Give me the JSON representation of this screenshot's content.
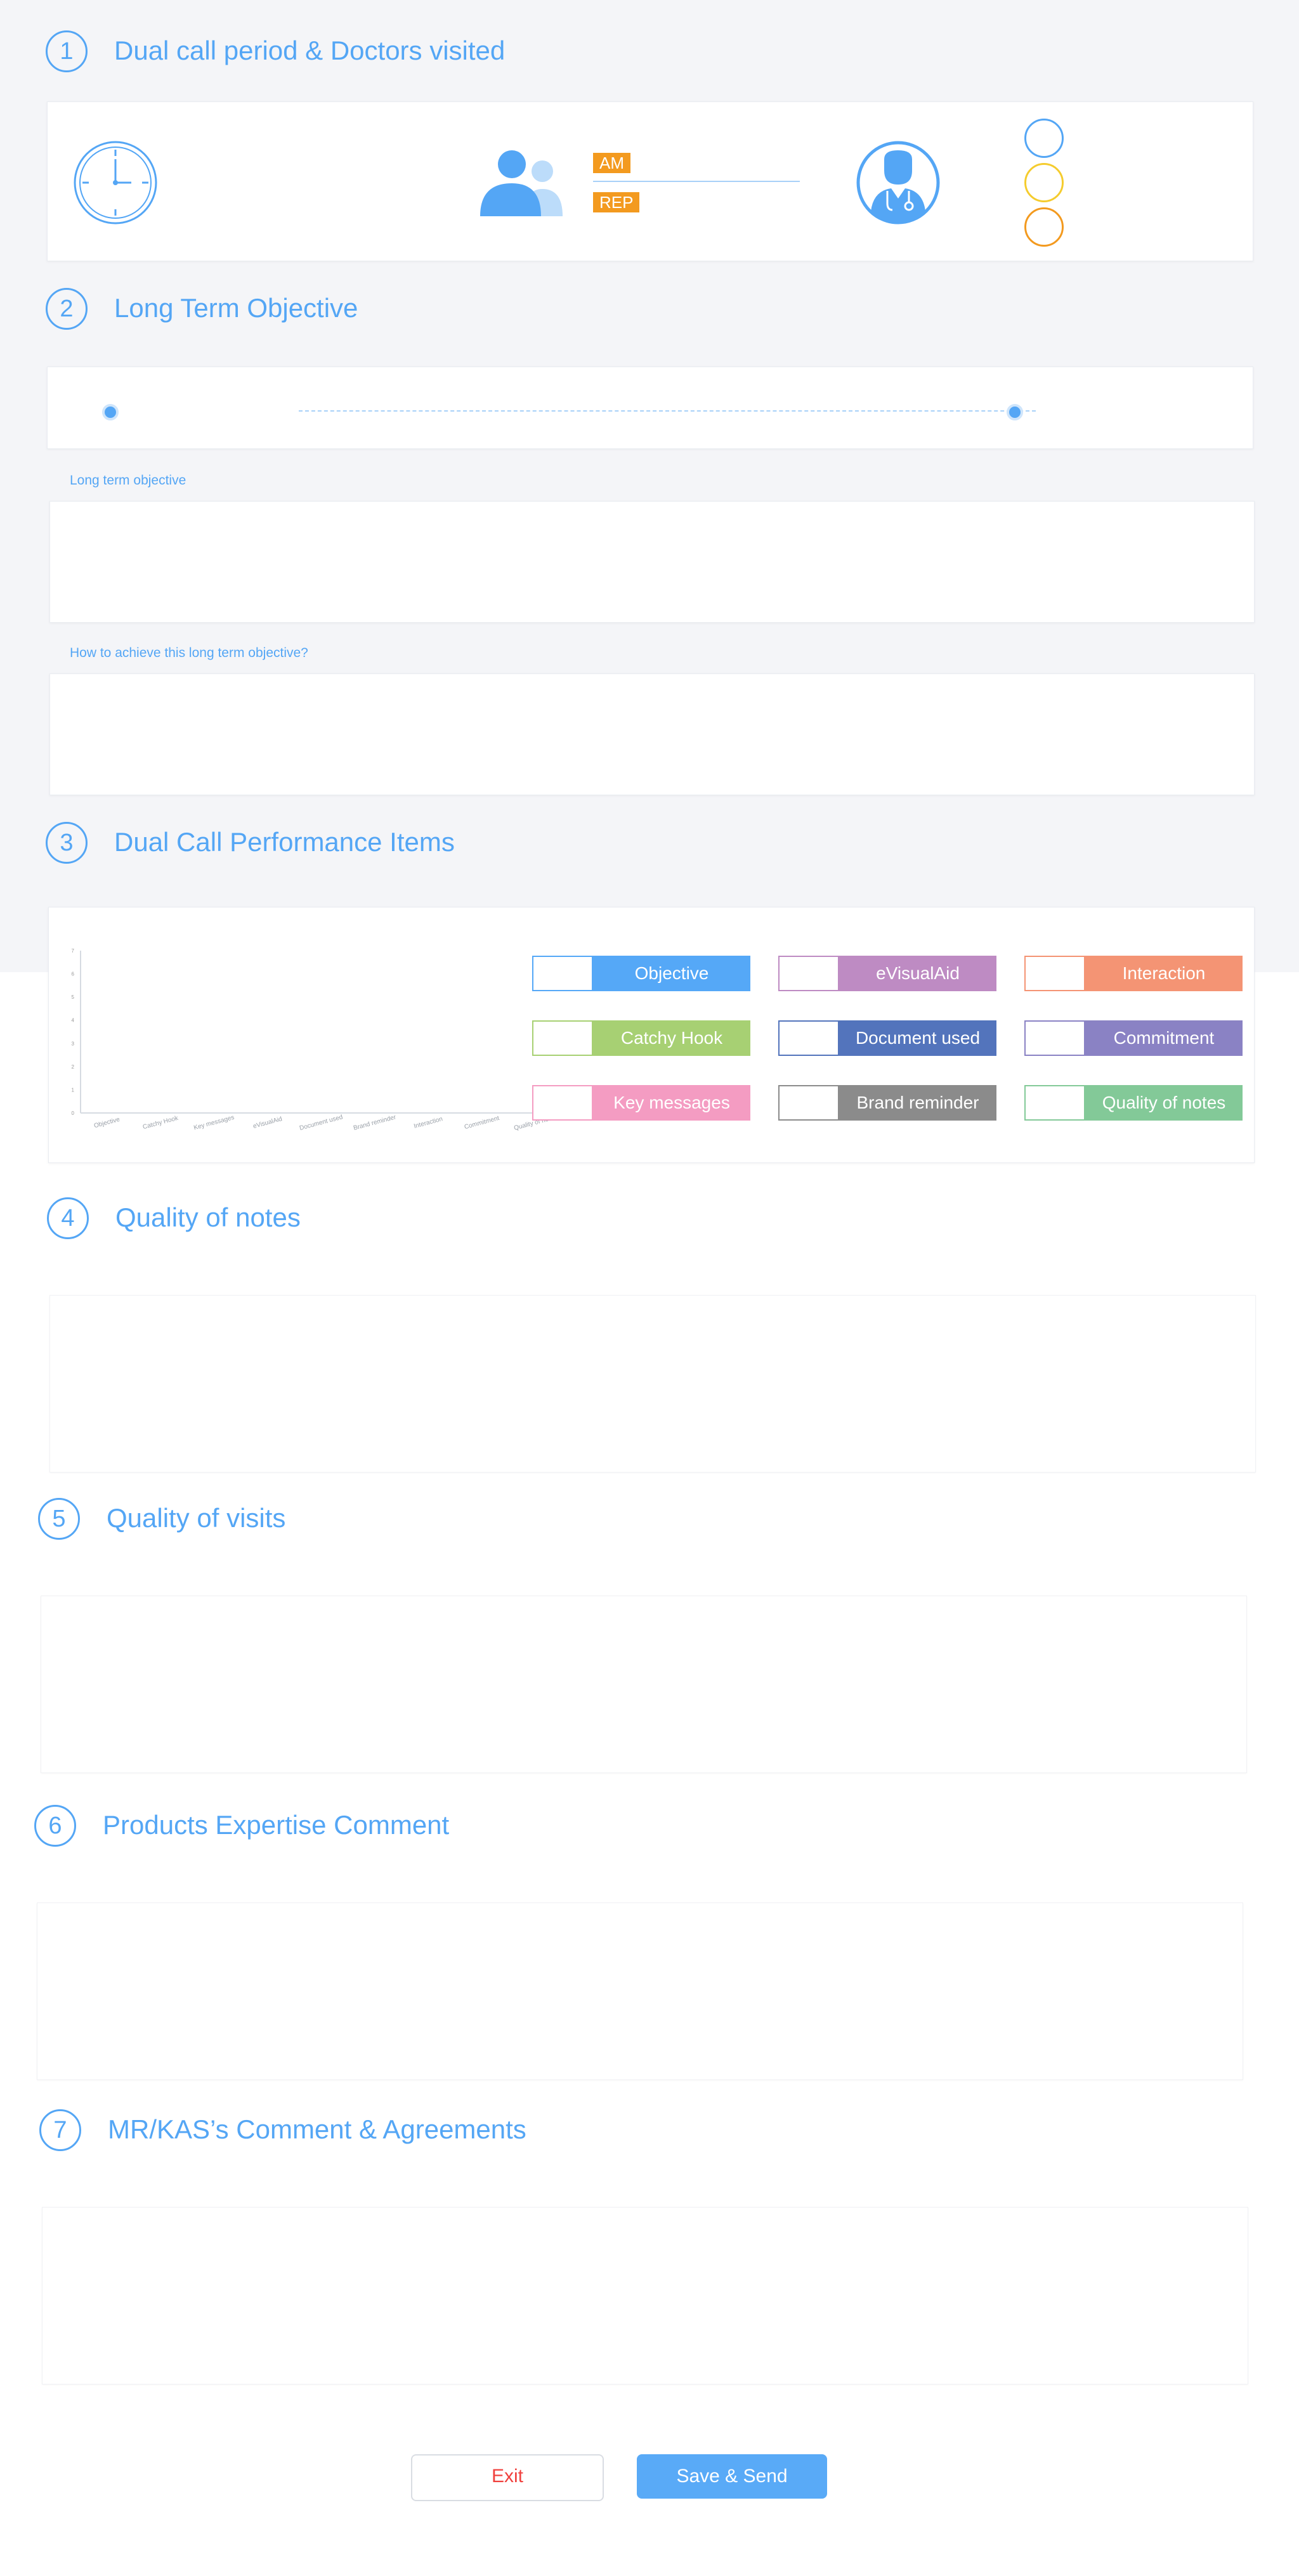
{
  "sections": [
    {
      "num": "1",
      "title": "Dual call period & Doctors visited"
    },
    {
      "num": "2",
      "title": "Long Term Objective"
    },
    {
      "num": "3",
      "title": "Dual Call Performance Items"
    },
    {
      "num": "4",
      "title": "Quality of notes"
    },
    {
      "num": "5",
      "title": "Quality of visits"
    },
    {
      "num": "6",
      "title": "Products Expertise Comment"
    },
    {
      "num": "7",
      "title": "MR/KAS’s Comment & Agreements"
    }
  ],
  "dual_call": {
    "am_badge": "AM",
    "rep_badge": "REP",
    "status_colors": [
      "#54a6f5",
      "#f5cc2e",
      "#f39a1f"
    ]
  },
  "objective": {
    "long_term_label": "Long term objective",
    "how_label": "How to achieve this long term objective?"
  },
  "performance": {
    "legend": [
      {
        "label": "Objective",
        "color": "#55a8f7"
      },
      {
        "label": "eVisualAid",
        "color": "#be8bc3"
      },
      {
        "label": "Interaction",
        "color": "#f49474"
      },
      {
        "label": "Catchy Hook",
        "color": "#a7d073"
      },
      {
        "label": "Document used",
        "color": "#5374bc"
      },
      {
        "label": "Commitment",
        "color": "#8a82c4"
      },
      {
        "label": "Key messages",
        "color": "#f49cc2"
      },
      {
        "label": "Brand reminder",
        "color": "#8b8b8b"
      },
      {
        "label": "Quality of notes",
        "color": "#83c998"
      }
    ]
  },
  "chart_data": {
    "type": "bar",
    "categories": [
      "Objective",
      "Catchy Hook",
      "Key messages",
      "eVisualAid",
      "Document used",
      "Brand reminder",
      "Interaction",
      "Commitment",
      "Quality of notes"
    ],
    "values": [],
    "y_ticks": [
      "0",
      "1",
      "2",
      "3",
      "4",
      "5",
      "6",
      "7"
    ],
    "ylim": [
      0,
      7
    ],
    "grid": false
  },
  "buttons": {
    "exit_label": "Exit",
    "save_label": "Save & Send"
  }
}
